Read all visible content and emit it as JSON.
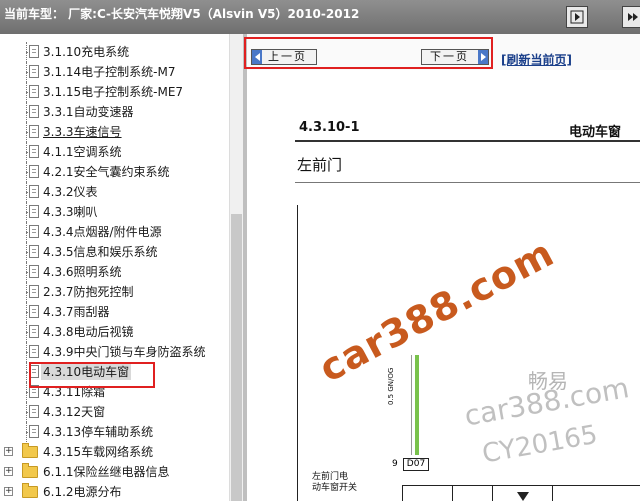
{
  "header": {
    "vehicle_label": "当前车型：  厂家:C-长安汽车悦翔V5（Alsvin V5）2010-2012"
  },
  "tree": {
    "items": [
      {
        "label": "3.1.10充电系统",
        "type": "doc"
      },
      {
        "label": "3.1.14电子控制系统-M7",
        "type": "doc"
      },
      {
        "label": "3.1.15电子控制系统-ME7",
        "type": "doc"
      },
      {
        "label": "3.3.1自动变速器",
        "type": "doc"
      },
      {
        "label": "3.3.3车速信号",
        "type": "doc"
      },
      {
        "label": "4.1.1空调系统",
        "type": "doc"
      },
      {
        "label": "4.2.1安全气囊约束系统",
        "type": "doc"
      },
      {
        "label": "4.3.2仪表",
        "type": "doc"
      },
      {
        "label": "4.3.3喇叭",
        "type": "doc"
      },
      {
        "label": "4.3.4点烟器/附件电源",
        "type": "doc"
      },
      {
        "label": "4.3.5信息和娱乐系统",
        "type": "doc"
      },
      {
        "label": "4.3.6照明系统",
        "type": "doc"
      },
      {
        "label": "2.3.7防抱死控制",
        "type": "doc"
      },
      {
        "label": "4.3.7雨刮器",
        "type": "doc"
      },
      {
        "label": "4.3.8电动后视镜",
        "type": "doc"
      },
      {
        "label": "4.3.9中央门锁与车身防盗系统",
        "type": "doc"
      },
      {
        "label": "4.3.10电动车窗",
        "type": "doc"
      },
      {
        "label": "4.3.11除霜",
        "type": "doc"
      },
      {
        "label": "4.3.12天窗",
        "type": "doc"
      },
      {
        "label": "4.3.13停车辅助系统",
        "type": "doc"
      },
      {
        "label": "4.3.15车载网络系统",
        "type": "folder"
      },
      {
        "label": "6.1.1保险丝继电器信息",
        "type": "folder"
      },
      {
        "label": "6.1.2电源分布",
        "type": "folder"
      }
    ]
  },
  "nav": {
    "prev_label": "上一页",
    "next_label": "下一页",
    "refresh_label": "[刷新当前页]"
  },
  "diagram": {
    "section": "4.3.10-1",
    "subtitle": "电动车窗",
    "door_title": "左前门",
    "wire_label": "0.5 GN/OG",
    "connector": "D07",
    "pin": "9",
    "switch_label_1": "左前门电",
    "switch_label_2": "动车窗开关"
  },
  "watermarks": {
    "main": "car388.com",
    "brand": "畅易",
    "site": "car388.com",
    "id": "CY20165"
  },
  "colors": {
    "header_bg": "#7f7f7f",
    "selected_bg": "#d9d9d9",
    "highlight_red": "#e02020",
    "wire_green": "#79c24c",
    "watermark_orange": "#c85a1e"
  }
}
